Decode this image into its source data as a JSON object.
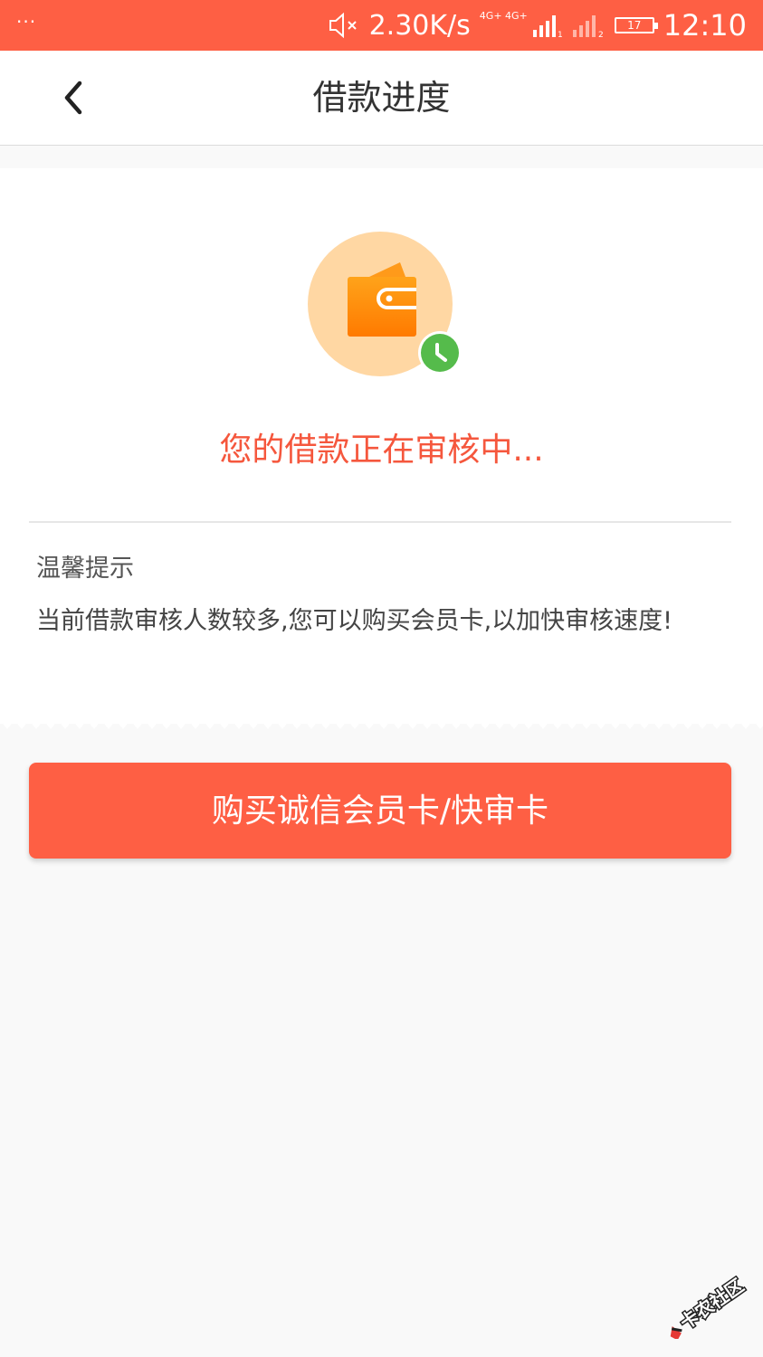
{
  "status_bar": {
    "dots": "···",
    "net_speed": "2.30K/s",
    "network_label": "4G+ 4G+",
    "battery": "17",
    "time": "12:10",
    "icons": [
      "mute-icon",
      "signal-icon",
      "signal-weak-icon",
      "battery-icon"
    ]
  },
  "nav": {
    "back_icon": "chevron-left-icon",
    "title": "借款进度"
  },
  "status": {
    "icon": "wallet-icon",
    "badge_icon": "clock-icon",
    "text": "您的借款正在审核中..."
  },
  "tips": {
    "title": "温馨提示",
    "body": "当前借款审核人数较多,您可以购买会员卡,以加快审核速度!"
  },
  "buy_button": {
    "label": "购买诚信会员卡/快审卡"
  },
  "watermark": {
    "text": "卡农社区"
  },
  "colors": {
    "brand": "#fe5f44",
    "status_text": "#f5573d",
    "wallet_bg": "#ffd7a3",
    "wallet": "#ff8a00",
    "clock": "#55bb4b"
  }
}
